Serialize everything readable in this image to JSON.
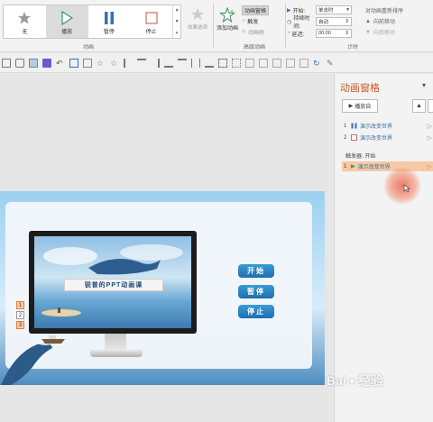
{
  "ribbon": {
    "gallery": {
      "items": [
        {
          "label": "无",
          "icon": "star-icon"
        },
        {
          "label": "播放",
          "icon": "play-icon"
        },
        {
          "label": "暂停",
          "icon": "pause-icon"
        },
        {
          "label": "停止",
          "icon": "stop-icon"
        }
      ],
      "selected_index": 1,
      "group_label": "动画"
    },
    "effect_options": {
      "label": "效果选项",
      "icon": "effect-options-icon"
    },
    "add_animation": {
      "label": "添加动画",
      "icon": "add-animation-icon"
    },
    "animation_pane": "动画窗格",
    "trigger": "触发",
    "animation_painter": "动画刷",
    "advanced_group_label": "高级动画",
    "timing": {
      "start_label": "开始:",
      "start_value": "单击时",
      "duration_label": "持续时间:",
      "duration_value": "自动",
      "delay_label": "延迟:",
      "delay_value": "00.00",
      "group_label": "计时"
    },
    "reorder": {
      "title": "对动画重新排序",
      "earlier": "向前移动",
      "later": "向后移动"
    }
  },
  "slide": {
    "screen_title": "锐普的PPT动画课",
    "buttons": [
      "开始",
      "暂停",
      "停止"
    ],
    "tags": [
      "1",
      "2",
      "3"
    ]
  },
  "animation_pane": {
    "title": "动画窗格",
    "play_from": "播放自",
    "items": [
      {
        "num": "1",
        "label": "演示改变世界",
        "icon": "pause-icon"
      },
      {
        "num": "2",
        "label": "演示改变世界",
        "icon": "stop-icon"
      }
    ],
    "trigger_label": "触发器: 开始",
    "trigger_item": {
      "num": "1",
      "label": "演示改变世界",
      "icon": "play-icon"
    }
  },
  "watermark": {
    "text": "Bai",
    "text2": "经验"
  },
  "colors": {
    "accent": "#c55b26",
    "highlight": "#f7c9a6",
    "slide_button": "#2580c0"
  }
}
